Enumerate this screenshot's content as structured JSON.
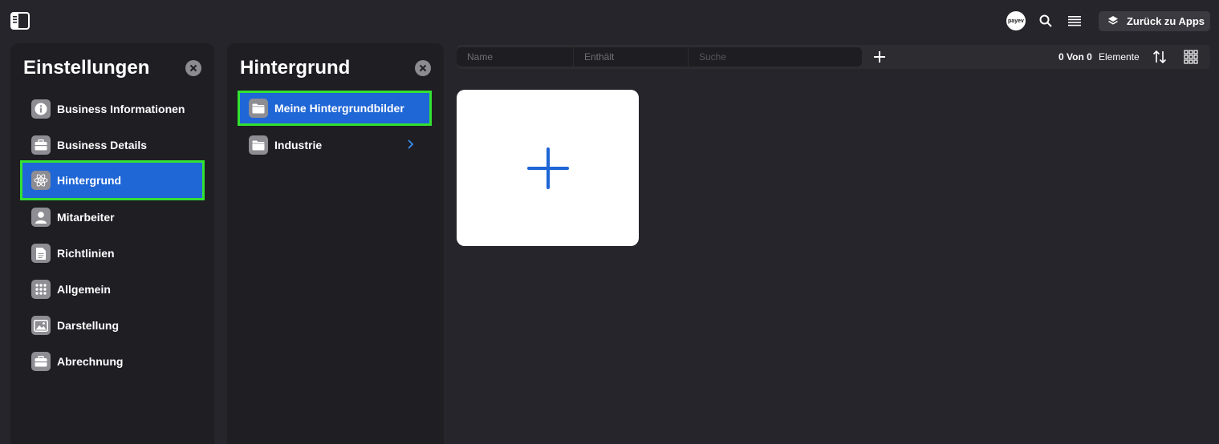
{
  "topbar": {
    "avatar_text": "payev",
    "back_button_label": "Zurück zu Apps"
  },
  "settings_panel": {
    "title": "Einstellungen",
    "items": [
      {
        "label": "Business Informationen",
        "icon": "info-icon"
      },
      {
        "label": "Business Details",
        "icon": "briefcase-icon"
      },
      {
        "label": "Hintergrund",
        "icon": "atom-icon",
        "active": true
      },
      {
        "label": "Mitarbeiter",
        "icon": "person-icon"
      },
      {
        "label": "Richtlinien",
        "icon": "document-icon"
      },
      {
        "label": "Allgemein",
        "icon": "grid-dots-icon"
      },
      {
        "label": "Darstellung",
        "icon": "image-icon"
      },
      {
        "label": "Abrechnung",
        "icon": "briefcase-icon"
      }
    ]
  },
  "background_panel": {
    "title": "Hintergrund",
    "items": [
      {
        "label": "Meine Hintergrundbilder",
        "icon": "folder-icon",
        "active": true
      },
      {
        "label": "Industrie",
        "icon": "folder-icon",
        "has_children": true
      }
    ]
  },
  "toolbar": {
    "filter_name": "Name",
    "filter_contains": "Enthält",
    "search_placeholder": "Suche",
    "count": "0 Von 0",
    "count_label": "Elemente"
  },
  "colors": {
    "background": "#25252b",
    "panel": "#1e1e23",
    "accent": "#1f66d6",
    "highlight": "#33e133"
  }
}
